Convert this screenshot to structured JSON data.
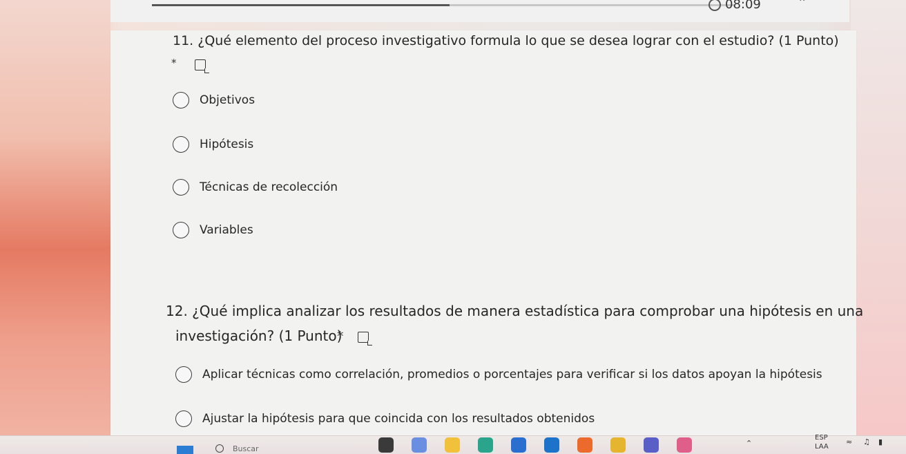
{
  "topbar": {
    "progress": 0.51,
    "timer": "08:09"
  },
  "form": {
    "questions": [
      {
        "title": "11. ¿Qué elemento del proceso investigativo formula lo que se desea lograr con el estudio? (1 Punto)",
        "required_mark": "*",
        "options": [
          "Objetivos",
          "Hipótesis",
          "Técnicas de recolección",
          "Variables"
        ]
      },
      {
        "title_line1": "12. ¿Qué implica analizar los resultados de manera estadística para comprobar una hipótesis en una",
        "title_line2": "investigación? (1 Punto)",
        "required_mark": "*",
        "options": [
          "Aplicar técnicas como correlación, promedios o porcentajes para verificar si los datos apoyan la hipótesis",
          "Ajustar la hipótesis para que coincida con los resultados obtenidos"
        ]
      }
    ]
  },
  "taskbar": {
    "search_placeholder": "Buscar",
    "language_top": "ESP",
    "language_bottom": "LAA",
    "apps": [
      {
        "name": "terminal",
        "color": "#3a3a3a"
      },
      {
        "name": "copilot",
        "color": "#6b8fe0"
      },
      {
        "name": "file-explorer",
        "color": "#f2c13c"
      },
      {
        "name": "edge",
        "color": "#2aa58c"
      },
      {
        "name": "microsoft-store",
        "color": "#2a6fcf"
      },
      {
        "name": "outlook",
        "color": "#1d73c9"
      },
      {
        "name": "firefox",
        "color": "#ec6b2c"
      },
      {
        "name": "chrome",
        "color": "#e5b52f"
      },
      {
        "name": "teams",
        "color": "#5a5fc7"
      },
      {
        "name": "snipping-tool",
        "color": "#e05f8a"
      }
    ]
  },
  "colors": {
    "card_bg": "#f2f2f0",
    "text": "#262626",
    "progress_fill": "#555555"
  }
}
